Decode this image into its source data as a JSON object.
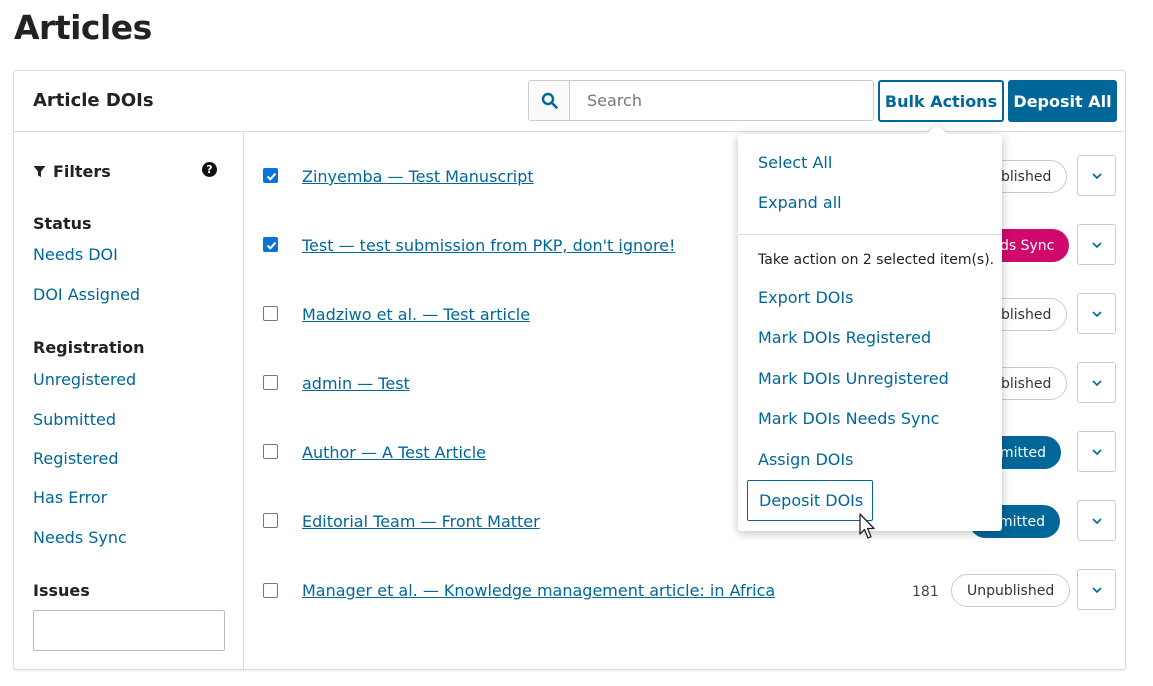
{
  "page": {
    "title": "Articles"
  },
  "panel": {
    "title": "Article DOIs",
    "search": {
      "placeholder": "Search",
      "value": ""
    },
    "bulk_actions_label": "Bulk Actions",
    "deposit_all_label": "Deposit All"
  },
  "filters": {
    "title": "Filters",
    "help_icon": "?",
    "status": {
      "label": "Status",
      "items": [
        "Needs DOI",
        "DOI Assigned"
      ]
    },
    "registration": {
      "label": "Registration",
      "items": [
        "Unregistered",
        "Submitted",
        "Registered",
        "Has Error",
        "Needs Sync"
      ]
    },
    "issues": {
      "label": "Issues",
      "value": ""
    }
  },
  "rows": [
    {
      "title": "Zinyemba — Test Manuscript",
      "checked": true,
      "status": "blished"
    },
    {
      "title": "Test — test submission from PKP, don't ignore!",
      "checked": true,
      "status": "ds Sync"
    },
    {
      "title": "Madziwo et al. — Test article",
      "checked": false,
      "status": "blished"
    },
    {
      "title": "admin — Test",
      "checked": false,
      "status": "blished"
    },
    {
      "title": "Author — A Test Article",
      "checked": false,
      "status": "mitted"
    },
    {
      "title": "Editorial Team — Front Matter",
      "checked": false,
      "status": "mitted"
    },
    {
      "title": "Manager et al. — Knowledge management article: in Africa",
      "checked": false,
      "id": "181",
      "status": "Unpublished"
    }
  ],
  "bulk_menu": {
    "select_all": "Select All",
    "expand_all": "Expand all",
    "caption": "Take action on 2 selected item(s).",
    "actions": [
      "Export DOIs",
      "Mark DOIs Registered",
      "Mark DOIs Unregistered",
      "Mark DOIs Needs Sync",
      "Assign DOIs",
      "Deposit DOIs"
    ]
  },
  "colors": {
    "primary": "#006798",
    "needs_sync": "#d00a6c",
    "checkbox": "#0b73d8"
  }
}
